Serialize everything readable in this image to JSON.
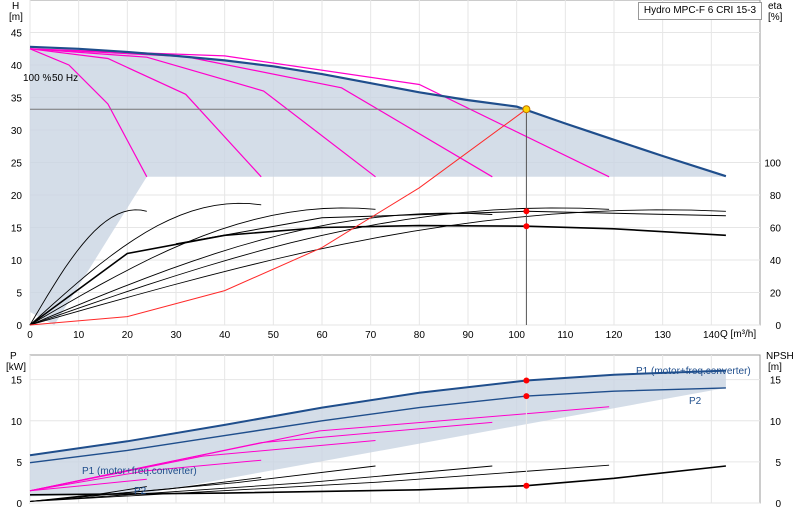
{
  "title_box": "Hydro MPC-F 6 CRI 15-3",
  "chart_data": [
    {
      "type": "line",
      "name_top": "performance",
      "xlabel": "Q [m³/h]",
      "ylabel_left": "H",
      "ylabel_left_unit": "[m]",
      "ylabel_right": "eta",
      "ylabel_right_unit": "[%]",
      "xlim": [
        0,
        150
      ],
      "ylim_left": [
        0,
        50
      ],
      "ylim_right_range": [
        0,
        100
      ],
      "x_ticks": [
        0,
        10,
        20,
        30,
        40,
        50,
        60,
        70,
        80,
        90,
        100,
        110,
        120,
        130,
        140
      ],
      "y_ticks_left": [
        0,
        5,
        10,
        15,
        20,
        25,
        30,
        35,
        40,
        45
      ],
      "y_ticks_right": [
        0,
        20,
        40,
        60,
        80,
        100
      ],
      "annotation_speed": "100 %",
      "annotation_freq": "50 Hz",
      "duty_point": {
        "q": 102,
        "h": 33.2
      },
      "eta_points": [
        {
          "q": 102,
          "eta": 17.5
        },
        {
          "q": 102,
          "eta": 15.2
        }
      ],
      "hq_main": {
        "x": [
          0,
          10,
          20,
          30,
          40,
          50,
          60,
          70,
          80,
          90,
          100,
          110,
          120,
          130,
          143
        ],
        "y": [
          42.8,
          42.5,
          42.0,
          41.4,
          40.7,
          39.8,
          38.6,
          37.2,
          35.8,
          34.6,
          33.6,
          31.0,
          28.5,
          26.0,
          22.9
        ]
      },
      "hq_pump_curves": [
        {
          "x": [
            0,
            8,
            16,
            24
          ],
          "y": [
            42.5,
            40,
            34,
            22.8
          ]
        },
        {
          "x": [
            0,
            16,
            32,
            47.5
          ],
          "y": [
            42.5,
            41,
            35.5,
            22.8
          ]
        },
        {
          "x": [
            0,
            24,
            48,
            71
          ],
          "y": [
            42.5,
            41.2,
            36,
            22.8
          ]
        },
        {
          "x": [
            0,
            32,
            64,
            95
          ],
          "y": [
            42.5,
            41.3,
            36.5,
            22.8
          ]
        },
        {
          "x": [
            0,
            40,
            80,
            119
          ],
          "y": [
            42.5,
            41.4,
            37,
            22.8
          ]
        }
      ],
      "system_curve": {
        "x": [
          0,
          20,
          40,
          60,
          80,
          102
        ],
        "y": [
          0,
          1.3,
          5.3,
          11.9,
          21.1,
          33.2
        ]
      }
    },
    {
      "type": "line",
      "name_top": "power",
      "xlabel": "",
      "ylabel_left": "P",
      "ylabel_left_unit": "[kW]",
      "ylabel_right": "NPSH",
      "ylabel_right_unit": "[m]",
      "xlim": [
        0,
        150
      ],
      "ylim_left": [
        0,
        18
      ],
      "y_ticks_left": [
        0,
        5,
        10,
        15
      ],
      "y_ticks_right": [
        0,
        5,
        10,
        15
      ],
      "series_labels": [
        "P1 (motor+freq.converter)",
        "P2",
        "P1 (motor+freq.converter)",
        "P2"
      ],
      "p1_main": {
        "x": [
          0,
          20,
          40,
          60,
          80,
          102,
          120,
          143
        ],
        "y": [
          5.8,
          7.5,
          9.5,
          11.6,
          13.4,
          14.9,
          15.6,
          16.1
        ]
      },
      "p2_main": {
        "x": [
          0,
          20,
          40,
          60,
          80,
          102,
          120,
          143
        ],
        "y": [
          4.9,
          6.4,
          8.2,
          10.0,
          11.6,
          13.0,
          13.6,
          14.0
        ]
      },
      "npsh": {
        "x": [
          0,
          40,
          80,
          102,
          120,
          143
        ],
        "y": [
          1.0,
          1.2,
          1.6,
          2.1,
          3.0,
          4.5
        ]
      },
      "marker_points": [
        {
          "q": 102,
          "p": 14.9
        },
        {
          "q": 102,
          "p": 13.0
        },
        {
          "q": 102,
          "p": 2.1
        }
      ]
    }
  ]
}
